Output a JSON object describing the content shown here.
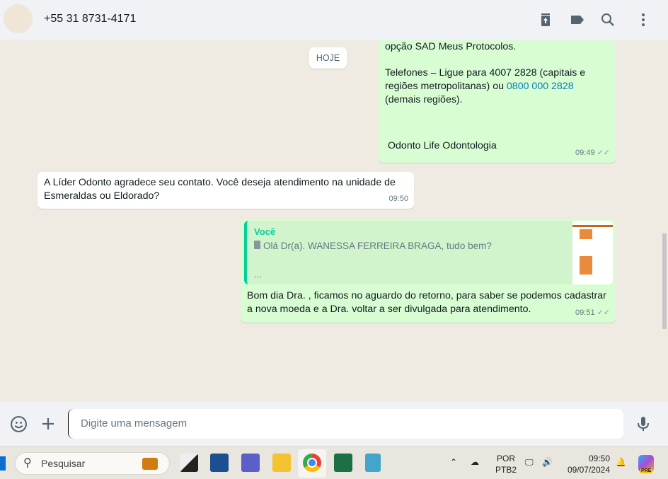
{
  "header": {
    "contact": "+55 31 8731-4171"
  },
  "chat": {
    "date_chip": "HOJE",
    "msg1": {
      "line1": "opção SAD Meus Protocolos.",
      "phones_pre": "Telefones – Ligue para 4007 2828 (capitais e regiões metropolitanas) ou ",
      "phone_link": "0800 000 2828",
      "phones_post": " (demais regiões).",
      "signature": "Odonto Life Odontologia",
      "time": "09:49"
    },
    "msg2": {
      "text": "A Líder Odonto agradece seu contato. Você deseja atendimento na unidade de Esmeraldas ou Eldorado?",
      "time": "09:50"
    },
    "msg3": {
      "quote_author": "Você",
      "quote_text": "Olá Dr(a). WANESSA FERREIRA BRAGA, tudo bem?",
      "quote_more": "...",
      "text": "Bom dia Dra. , ficamos no aguardo do retorno, para saber se podemos cadastrar a nova moeda e a Dra. voltar a ser divulgada para atendimento.",
      "time": "09:51"
    }
  },
  "composer": {
    "placeholder": "Digite uma mensagem"
  },
  "taskbar": {
    "search": "Pesquisar",
    "lang1": "POR",
    "lang2": "PTB2",
    "time": "09:50",
    "date": "09/07/2024",
    "copilot_badge": "PRE"
  }
}
